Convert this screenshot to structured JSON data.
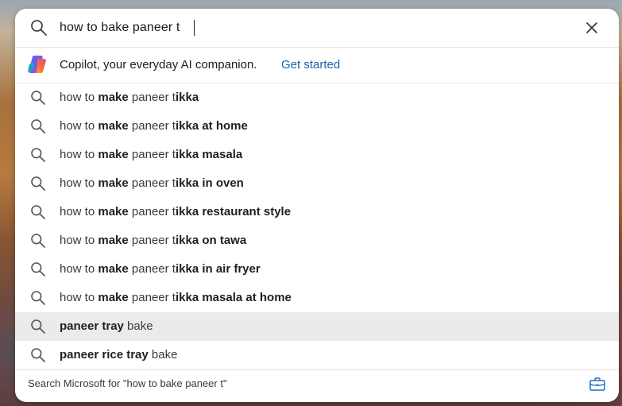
{
  "search": {
    "query": "how to bake paneer t"
  },
  "copilot": {
    "text": "Copilot, your everyday AI companion.",
    "cta": "Get started"
  },
  "suggestions": [
    {
      "parts": [
        {
          "t": "how to ",
          "b": false
        },
        {
          "t": "make",
          "b": true
        },
        {
          "t": " paneer t",
          "b": false
        },
        {
          "t": "ikka",
          "b": true
        }
      ],
      "highlighted": false
    },
    {
      "parts": [
        {
          "t": "how to ",
          "b": false
        },
        {
          "t": "make",
          "b": true
        },
        {
          "t": " paneer t",
          "b": false
        },
        {
          "t": "ikka at home",
          "b": true
        }
      ],
      "highlighted": false
    },
    {
      "parts": [
        {
          "t": "how to ",
          "b": false
        },
        {
          "t": "make",
          "b": true
        },
        {
          "t": " paneer t",
          "b": false
        },
        {
          "t": "ikka masala",
          "b": true
        }
      ],
      "highlighted": false
    },
    {
      "parts": [
        {
          "t": "how to ",
          "b": false
        },
        {
          "t": "make",
          "b": true
        },
        {
          "t": " paneer t",
          "b": false
        },
        {
          "t": "ikka in oven",
          "b": true
        }
      ],
      "highlighted": false
    },
    {
      "parts": [
        {
          "t": "how to ",
          "b": false
        },
        {
          "t": "make",
          "b": true
        },
        {
          "t": " paneer t",
          "b": false
        },
        {
          "t": "ikka restaurant style",
          "b": true
        }
      ],
      "highlighted": false
    },
    {
      "parts": [
        {
          "t": "how to ",
          "b": false
        },
        {
          "t": "make",
          "b": true
        },
        {
          "t": " paneer t",
          "b": false
        },
        {
          "t": "ikka on tawa",
          "b": true
        }
      ],
      "highlighted": false
    },
    {
      "parts": [
        {
          "t": "how to ",
          "b": false
        },
        {
          "t": "make",
          "b": true
        },
        {
          "t": " paneer t",
          "b": false
        },
        {
          "t": "ikka in air fryer",
          "b": true
        }
      ],
      "highlighted": false
    },
    {
      "parts": [
        {
          "t": "how to ",
          "b": false
        },
        {
          "t": "make",
          "b": true
        },
        {
          "t": " paneer t",
          "b": false
        },
        {
          "t": "ikka masala at home",
          "b": true
        }
      ],
      "highlighted": false
    },
    {
      "parts": [
        {
          "t": "paneer tray",
          "b": true
        },
        {
          "t": " bake",
          "b": false
        }
      ],
      "highlighted": true
    },
    {
      "parts": [
        {
          "t": "paneer rice tray",
          "b": true
        },
        {
          "t": " bake",
          "b": false
        }
      ],
      "highlighted": false
    }
  ],
  "footer": {
    "text": "Search Microsoft for \"how to bake paneer t\""
  },
  "icons": {
    "search": "search-icon",
    "close": "close-icon",
    "copilot": "copilot-logo-icon",
    "suggestion": "search-icon",
    "footer": "briefcase-icon"
  },
  "colors": {
    "link": "#1a64a8",
    "highlight_row": "#ebebeb",
    "briefcase": "#1f6fc5"
  }
}
